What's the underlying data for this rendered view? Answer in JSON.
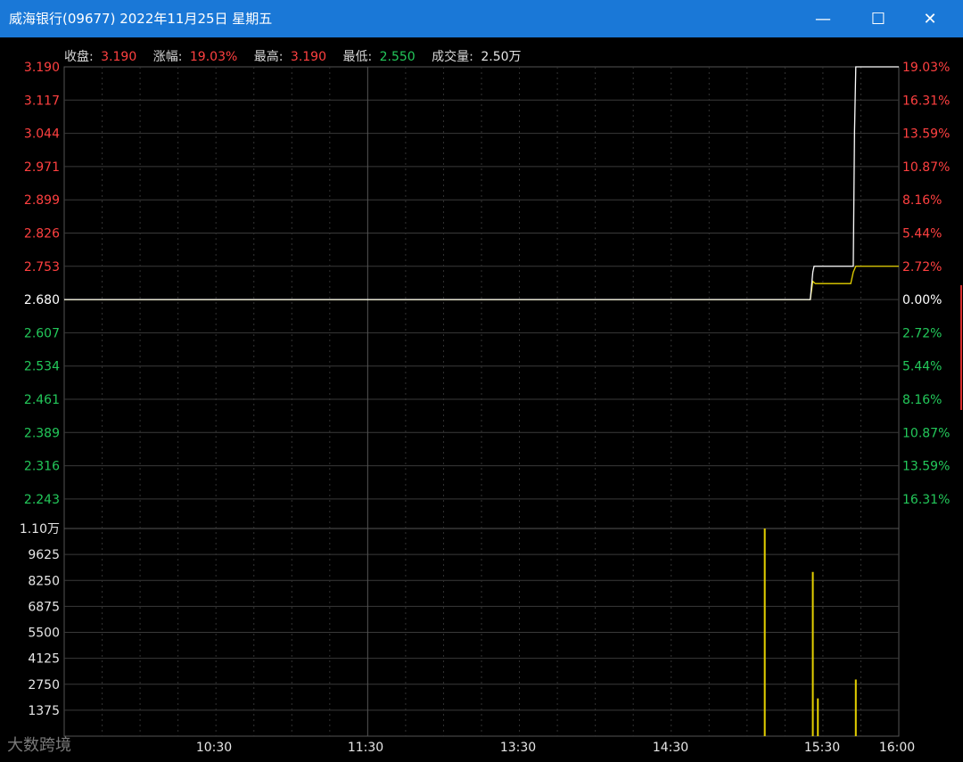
{
  "window": {
    "title": "威海银行(09677)  2022年11月25日  星期五",
    "minimize_glyph": "—",
    "maximize_glyph": "☐",
    "close_glyph": "✕"
  },
  "infobar": {
    "close_label": "收盘:",
    "close_value": "3.190",
    "change_label": "涨幅:",
    "change_value": "19.03%",
    "high_label": "最高:",
    "high_value": "3.190",
    "low_label": "最低:",
    "low_value": "2.550",
    "volume_label": "成交量:",
    "volume_value": "2.50万"
  },
  "watermark": "大数跨境",
  "colors": {
    "up": "#ff4040",
    "down": "#23c85a",
    "neutral": "#ffffff",
    "price_line": "#ffffff",
    "avg_line": "#e6d200",
    "volume_bar": "#e6d200",
    "grid": "#3a3a3a",
    "background": "#000000"
  },
  "chart_data": {
    "type": "line",
    "prev_close": 2.68,
    "price_axis": {
      "ticks": [
        "3.190",
        "3.117",
        "3.044",
        "2.971",
        "2.899",
        "2.826",
        "2.753",
        "2.680",
        "2.607",
        "2.534",
        "2.461",
        "2.389",
        "2.316",
        "2.243"
      ],
      "ylim": [
        2.2065,
        3.19
      ]
    },
    "percent_axis": {
      "ticks": [
        "19.03%",
        "16.31%",
        "13.59%",
        "10.87%",
        "8.16%",
        "5.44%",
        "2.72%",
        "0.00%",
        "2.72%",
        "5.44%",
        "8.16%",
        "10.87%",
        "13.59%",
        "16.31%"
      ]
    },
    "volume_axis": {
      "ticks": [
        "1.10万",
        "9625",
        "8250",
        "6875",
        "5500",
        "4125",
        "2750",
        "1375"
      ],
      "ylim": [
        0,
        11000
      ]
    },
    "time_axis": {
      "ticks": [
        "10:30",
        "11:30",
        "13:30",
        "14:30",
        "15:30",
        "16:00"
      ],
      "x_range": [
        0,
        330
      ]
    },
    "series": [
      {
        "name": "price",
        "x": [
          0,
          295,
          296,
          296.5,
          312,
          312.5,
          313,
          330
        ],
        "y": [
          2.68,
          2.68,
          2.74,
          2.753,
          2.753,
          3.05,
          3.19,
          3.19
        ]
      },
      {
        "name": "average",
        "x": [
          0,
          295,
          296,
          297,
          311,
          312,
          313,
          330
        ],
        "y": [
          2.68,
          2.68,
          2.72,
          2.715,
          2.715,
          2.74,
          2.753,
          2.753
        ]
      }
    ],
    "volume": {
      "x": [
        277,
        296,
        298,
        313
      ],
      "values": [
        11000,
        8700,
        2000,
        3000
      ]
    }
  }
}
